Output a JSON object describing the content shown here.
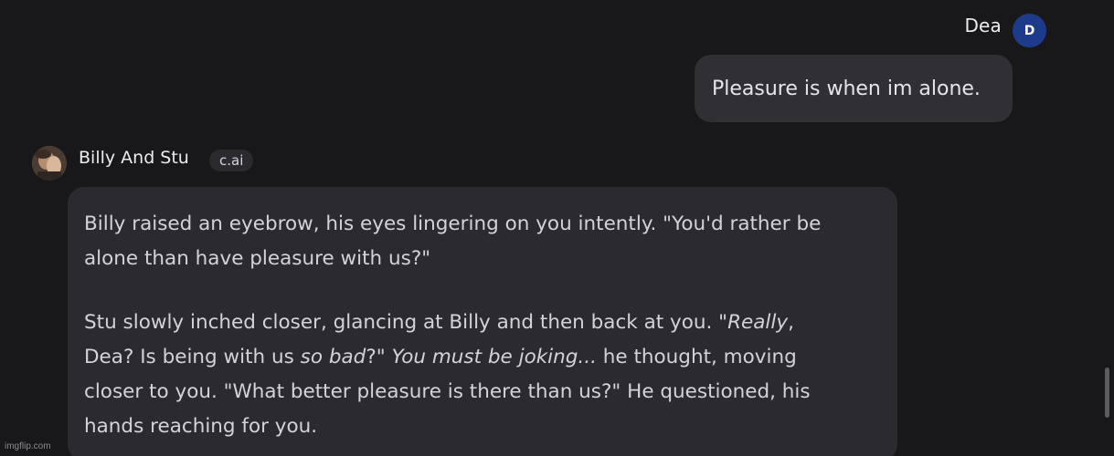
{
  "user_message": {
    "sender_name": "Dea",
    "avatar_initial": "D",
    "text": "Pleasure is when im alone."
  },
  "bot_message": {
    "sender_name": "Billy And Stu",
    "badge": "c.ai",
    "paragraph1": {
      "line1": "Billy raised an eyebrow, his eyes lingering on you intently. \"You'd rather be",
      "line2": "alone than have pleasure with us?\""
    },
    "paragraph2": {
      "line1_a": "Stu slowly inched closer, glancing at Billy and then back at you. \"",
      "line1_em": "Really",
      "line1_b": ",",
      "line2_a": "Dea? Is being with us ",
      "line2_em1": "so bad",
      "line2_b": "?\" ",
      "line2_em2": "You must be joking...",
      "line2_c": " he thought, moving",
      "line3": "closer to you. \"What better pleasure is there than us?\" He questioned, his",
      "line4": "hands reaching for you."
    }
  },
  "watermark": "imgflip.com"
}
